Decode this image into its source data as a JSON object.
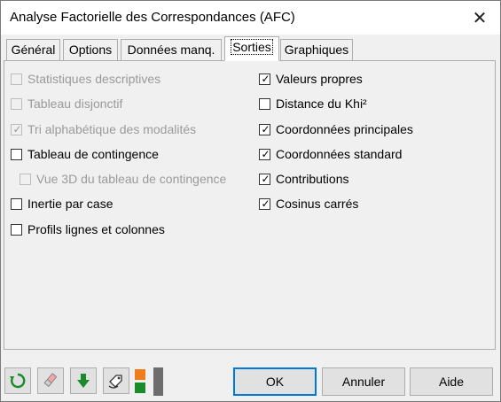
{
  "window": {
    "title": "Analyse Factorielle des Correspondances (AFC)"
  },
  "tabs": [
    {
      "label": "Général",
      "active": false
    },
    {
      "label": "Options",
      "active": false
    },
    {
      "label": "Données manq.",
      "active": false
    },
    {
      "label": "Sorties",
      "active": true
    },
    {
      "label": "Graphiques",
      "active": false
    }
  ],
  "left_options": [
    {
      "label": "Statistiques descriptives",
      "checked": false,
      "enabled": false
    },
    {
      "label": "Tableau disjonctif",
      "checked": false,
      "enabled": false
    },
    {
      "label": "Tri alphabétique des modalités",
      "checked": true,
      "enabled": false
    },
    {
      "label": "Tableau de contingence",
      "checked": false,
      "enabled": true
    },
    {
      "label": "Vue 3D du tableau de contingence",
      "checked": false,
      "enabled": false
    },
    {
      "label": "Inertie par case",
      "checked": false,
      "enabled": true
    },
    {
      "label": "Profils lignes et colonnes",
      "checked": false,
      "enabled": true
    }
  ],
  "right_options": [
    {
      "label": "Valeurs propres",
      "checked": true,
      "enabled": true
    },
    {
      "label": "Distance du Khi²",
      "checked": false,
      "enabled": true
    },
    {
      "label": "Coordonnées principales",
      "checked": true,
      "enabled": true
    },
    {
      "label": "Coordonnées standard",
      "checked": true,
      "enabled": true
    },
    {
      "label": "Contributions",
      "checked": true,
      "enabled": true
    },
    {
      "label": "Cosinus carrés",
      "checked": true,
      "enabled": true
    }
  ],
  "buttons": {
    "ok": "OK",
    "cancel": "Annuler",
    "help": "Aide"
  },
  "icons": [
    "reset-icon",
    "eraser-icon",
    "download-arrow-icon",
    "tag-icon",
    "layout-toggle-icon"
  ],
  "colors": {
    "accent": "#0078d7",
    "green": "#1a8a2a",
    "orange": "#f07d1a"
  }
}
